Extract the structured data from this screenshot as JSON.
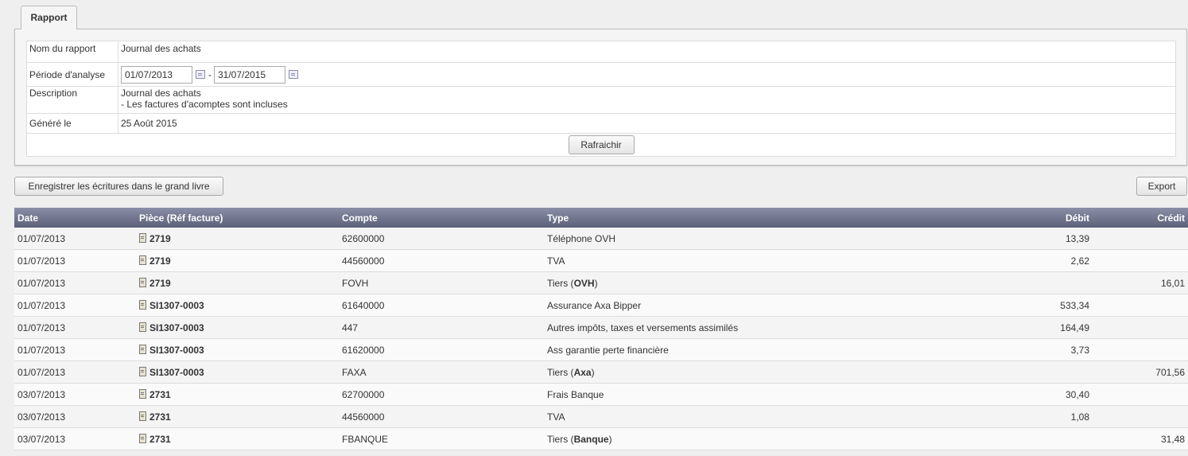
{
  "tab": {
    "label": "Rapport"
  },
  "report": {
    "name_label": "Nom du rapport",
    "name_value": "Journal des achats",
    "period_label": "Période d'analyse",
    "date_from": "01/07/2013",
    "date_separator": "-",
    "date_to": "31/07/2015",
    "description_label": "Description",
    "description_line1": "Journal des achats",
    "description_line2": "- Les factures d'acomptes sont incluses",
    "generated_label": "Généré le",
    "generated_value": "25 Août 2015",
    "refresh_label": "Rafraichir"
  },
  "actions": {
    "save_label": "Enregistrer les écritures dans le grand livre",
    "export_label": "Export"
  },
  "table": {
    "headers": {
      "date": "Date",
      "piece": "Pièce (Réf facture)",
      "compte": "Compte",
      "type": "Type",
      "debit": "Débit",
      "credit": "Crédit"
    },
    "rows": [
      {
        "date": "01/07/2013",
        "piece": "2719",
        "compte": "62600000",
        "type": "Téléphone OVH",
        "debit": "13,39",
        "credit": ""
      },
      {
        "date": "01/07/2013",
        "piece": "2719",
        "compte": "44560000",
        "type": "TVA",
        "debit": "2,62",
        "credit": ""
      },
      {
        "date": "01/07/2013",
        "piece": "2719",
        "compte": "FOVH",
        "type_prefix": "Tiers (",
        "type_bold": "OVH",
        "type_suffix": ")",
        "debit": "",
        "credit": "16,01"
      },
      {
        "date": "01/07/2013",
        "piece": "SI1307-0003",
        "compte": "61640000",
        "type": "Assurance Axa Bipper",
        "debit": "533,34",
        "credit": ""
      },
      {
        "date": "01/07/2013",
        "piece": "SI1307-0003",
        "compte": "447",
        "type": "Autres impôts, taxes et versements assimilés",
        "debit": "164,49",
        "credit": ""
      },
      {
        "date": "01/07/2013",
        "piece": "SI1307-0003",
        "compte": "61620000",
        "type": "Ass garantie perte financière",
        "debit": "3,73",
        "credit": ""
      },
      {
        "date": "01/07/2013",
        "piece": "SI1307-0003",
        "compte": "FAXA",
        "type_prefix": "Tiers (",
        "type_bold": "Axa",
        "type_suffix": ")",
        "debit": "",
        "credit": "701,56"
      },
      {
        "date": "03/07/2013",
        "piece": "2731",
        "compte": "62700000",
        "type": "Frais Banque",
        "debit": "30,40",
        "credit": ""
      },
      {
        "date": "03/07/2013",
        "piece": "2731",
        "compte": "44560000",
        "type": "TVA",
        "debit": "1,08",
        "credit": ""
      },
      {
        "date": "03/07/2013",
        "piece": "2731",
        "compte": "FBANQUE",
        "type_prefix": "Tiers (",
        "type_bold": "Banque",
        "type_suffix": ")",
        "debit": "",
        "credit": "31,48"
      }
    ]
  }
}
